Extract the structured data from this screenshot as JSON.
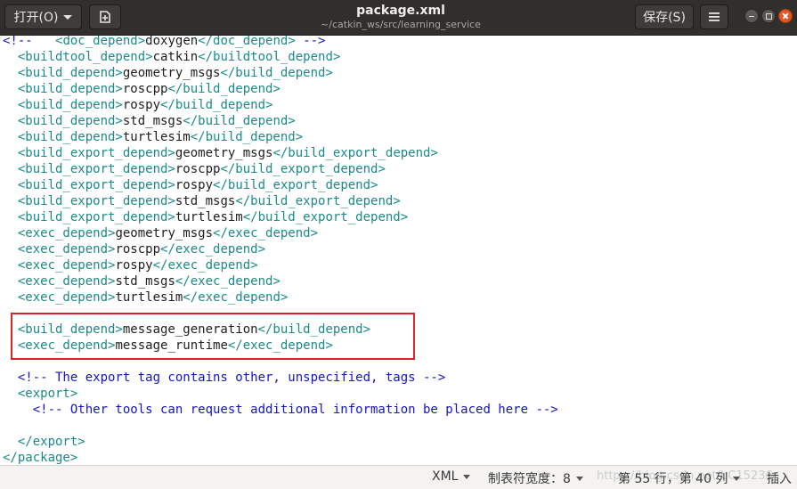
{
  "window": {
    "title": "package.xml",
    "path": "~/catkin_ws/src/learning_service"
  },
  "toolbar": {
    "open_label": "打开(O)",
    "save_label": "保存(S)"
  },
  "editor": {
    "lines": [
      [
        [
          "cmt",
          "<!-- "
        ],
        [
          "tag",
          "  <doc_depend>"
        ],
        [
          "txt",
          "doxygen"
        ],
        [
          "tag",
          "</doc_depend>"
        ],
        [
          "cmt",
          " -->"
        ]
      ],
      [
        [
          "tag",
          "  <buildtool_depend>"
        ],
        [
          "txt",
          "catkin"
        ],
        [
          "tag",
          "</buildtool_depend>"
        ]
      ],
      [
        [
          "tag",
          "  <build_depend>"
        ],
        [
          "txt",
          "geometry_msgs"
        ],
        [
          "tag",
          "</build_depend>"
        ]
      ],
      [
        [
          "tag",
          "  <build_depend>"
        ],
        [
          "txt",
          "roscpp"
        ],
        [
          "tag",
          "</build_depend>"
        ]
      ],
      [
        [
          "tag",
          "  <build_depend>"
        ],
        [
          "txt",
          "rospy"
        ],
        [
          "tag",
          "</build_depend>"
        ]
      ],
      [
        [
          "tag",
          "  <build_depend>"
        ],
        [
          "txt",
          "std_msgs"
        ],
        [
          "tag",
          "</build_depend>"
        ]
      ],
      [
        [
          "tag",
          "  <build_depend>"
        ],
        [
          "txt",
          "turtlesim"
        ],
        [
          "tag",
          "</build_depend>"
        ]
      ],
      [
        [
          "tag",
          "  <build_export_depend>"
        ],
        [
          "txt",
          "geometry_msgs"
        ],
        [
          "tag",
          "</build_export_depend>"
        ]
      ],
      [
        [
          "tag",
          "  <build_export_depend>"
        ],
        [
          "txt",
          "roscpp"
        ],
        [
          "tag",
          "</build_export_depend>"
        ]
      ],
      [
        [
          "tag",
          "  <build_export_depend>"
        ],
        [
          "txt",
          "rospy"
        ],
        [
          "tag",
          "</build_export_depend>"
        ]
      ],
      [
        [
          "tag",
          "  <build_export_depend>"
        ],
        [
          "txt",
          "std_msgs"
        ],
        [
          "tag",
          "</build_export_depend>"
        ]
      ],
      [
        [
          "tag",
          "  <build_export_depend>"
        ],
        [
          "txt",
          "turtlesim"
        ],
        [
          "tag",
          "</build_export_depend>"
        ]
      ],
      [
        [
          "tag",
          "  <exec_depend>"
        ],
        [
          "txt",
          "geometry_msgs"
        ],
        [
          "tag",
          "</exec_depend>"
        ]
      ],
      [
        [
          "tag",
          "  <exec_depend>"
        ],
        [
          "txt",
          "roscpp"
        ],
        [
          "tag",
          "</exec_depend>"
        ]
      ],
      [
        [
          "tag",
          "  <exec_depend>"
        ],
        [
          "txt",
          "rospy"
        ],
        [
          "tag",
          "</exec_depend>"
        ]
      ],
      [
        [
          "tag",
          "  <exec_depend>"
        ],
        [
          "txt",
          "std_msgs"
        ],
        [
          "tag",
          "</exec_depend>"
        ]
      ],
      [
        [
          "tag",
          "  <exec_depend>"
        ],
        [
          "txt",
          "turtlesim"
        ],
        [
          "tag",
          "</exec_depend>"
        ]
      ],
      [],
      [
        [
          "tag",
          "  <build_depend>"
        ],
        [
          "txt",
          "message_generation"
        ],
        [
          "tag",
          "</build_depend>"
        ]
      ],
      [
        [
          "tag",
          "  <exec_depend>"
        ],
        [
          "txt",
          "message_runtime"
        ],
        [
          "tag",
          "</exec_depend>"
        ]
      ],
      [],
      [
        [
          "cmt",
          "  <!-- The export tag contains other, unspecified, tags -->"
        ]
      ],
      [
        [
          "tag",
          "  <export>"
        ]
      ],
      [
        [
          "cmt",
          "    <!-- Other tools can request additional information be placed here -->"
        ]
      ],
      [],
      [
        [
          "tag",
          "  </export>"
        ]
      ],
      [
        [
          "tag",
          "</package>"
        ]
      ]
    ]
  },
  "statusbar": {
    "language": "XML",
    "tab_width": "制表符宽度：8",
    "position": "第 55 行，第 40 列",
    "mode": "插入",
    "watermark": "https://blog.csdn.net/bC15236"
  },
  "icons": {
    "open_dropdown": "chevron-down-icon",
    "new_document": "new-document-icon",
    "menu": "hamburger-menu-icon",
    "minimize": "minimize-icon",
    "maximize": "maximize-icon",
    "close": "close-icon"
  },
  "colors": {
    "tag": "#1a8a8a",
    "text": "#202020",
    "comment": "#1414c8",
    "highlight_box": "#d9262b",
    "titlebar": "#302f2c",
    "close_button": "#e9541f"
  }
}
